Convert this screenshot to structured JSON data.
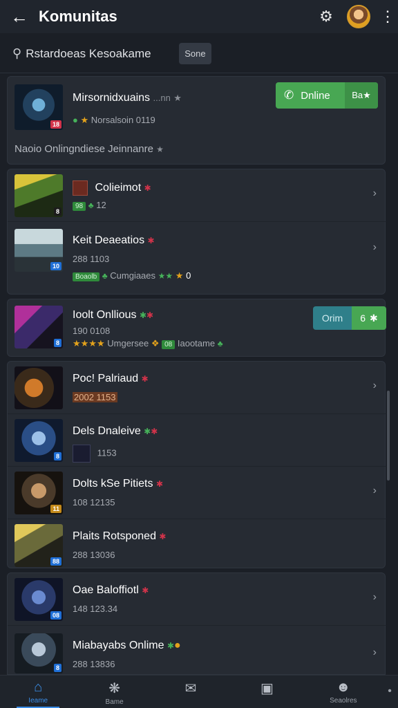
{
  "header": {
    "title": "Komunitas",
    "back_icon": "arrow-left-icon",
    "settings_icon": "gear-icon",
    "more_icon": "more-vertical-icon"
  },
  "search": {
    "value": "Rstardoeas Kesoakame",
    "button_label": "Sone"
  },
  "featured": {
    "name": "Mirsornidxuains",
    "name_suffix": "...nn",
    "meta": "Norsalsoin 0119",
    "badge": "18",
    "online_label": "Dnline",
    "online_count": "Ba★",
    "description": "Naoio Onlingndiese Jeinnanre"
  },
  "group1": [
    {
      "name": "Colieimot",
      "meta": "12",
      "tag": "98",
      "badge": "8",
      "badge_color": "#1c1c1c"
    },
    {
      "name": "Keit Deaeatios",
      "meta": "288 1103",
      "meta2": "Cumgiaaes",
      "tag": "Boaolb",
      "count": "0",
      "badge": "10",
      "badge_color": "#1f6fd6"
    }
  ],
  "group2": {
    "name": "Ioolt Onllious",
    "meta": "190 0108",
    "meta2": "Umgersee",
    "tag": "08",
    "meta3": "Iaootame",
    "badge": "8",
    "badge_color": "#1f6fd6",
    "toggle_label": "Orim",
    "toggle_count": "6"
  },
  "group3": [
    {
      "name": "Poc! Palriaud",
      "meta": "2002 1153",
      "badge": "",
      "badge_color": "#1f6fd6"
    },
    {
      "name": "Dels Dnaleive",
      "meta": "1153",
      "badge": "8",
      "badge_color": "#1f6fd6"
    },
    {
      "name": "Dolts kSe Pitiets",
      "meta": "108 12135",
      "badge": "11",
      "badge_color": "#c48a1a"
    },
    {
      "name": "Plaits Rotsponed",
      "meta": "288 13036",
      "badge": "88",
      "badge_color": "#1f6fd6"
    }
  ],
  "group4": [
    {
      "name": "Oae Baloffiotl",
      "meta": "148 123.34",
      "badge": "08",
      "badge_color": "#1f6fd6"
    },
    {
      "name": "Miabayabs Onlime",
      "meta": "288 13836",
      "badge": "8",
      "badge_color": "#1f6fd6"
    }
  ],
  "nav": [
    {
      "label": "Ieame",
      "icon": "home-icon"
    },
    {
      "label": "Bame",
      "icon": "game-icon"
    },
    {
      "label": "",
      "icon": "mail-icon"
    },
    {
      "label": "",
      "icon": "notification-icon"
    },
    {
      "label": "Seaolres",
      "icon": "profile-icon"
    }
  ],
  "colors": {
    "accent": "#3b8ee8",
    "online_green": "#48a753",
    "background": "#1b1f26",
    "card": "#262b33"
  }
}
